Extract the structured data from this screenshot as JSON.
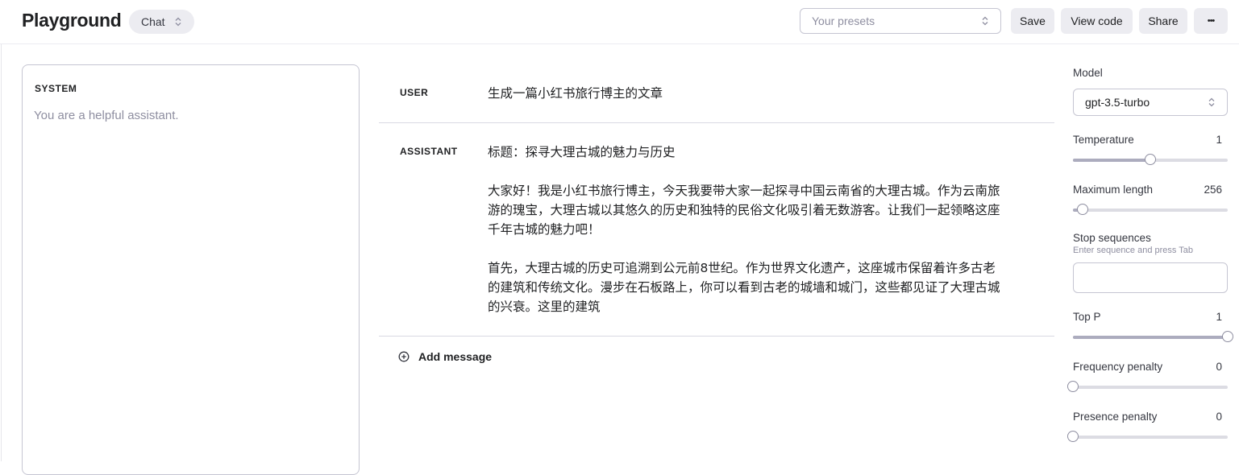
{
  "header": {
    "title": "Playground",
    "mode": "Chat",
    "presets_placeholder": "Your presets",
    "save_label": "Save",
    "view_code_label": "View code",
    "share_label": "Share",
    "more_label": "•••"
  },
  "system": {
    "label": "SYSTEM",
    "placeholder": "You are a helpful assistant."
  },
  "messages": [
    {
      "role": "USER",
      "paragraphs": [
        "生成一篇小红书旅行博主的文章"
      ]
    },
    {
      "role": "ASSISTANT",
      "paragraphs": [
        "标题：探寻大理古城的魅力与历史",
        "大家好！我是小红书旅行博主，今天我要带大家一起探寻中国云南省的大理古城。作为云南旅游的瑰宝，大理古城以其悠久的历史和独特的民俗文化吸引着无数游客。让我们一起领略这座千年古城的魅力吧！",
        "首先，大理古城的历史可追溯到公元前8世纪。作为世界文化遗产，这座城市保留着许多古老的建筑和传统文化。漫步在石板路上，你可以看到古老的城墙和城门，这些都见证了大理古城的兴衰。这里的建筑"
      ]
    }
  ],
  "add_message_label": "Add message",
  "settings": {
    "model_label": "Model",
    "model_value": "gpt-3.5-turbo",
    "temperature": {
      "label": "Temperature",
      "value": "1",
      "fraction": 0.5
    },
    "max_length": {
      "label": "Maximum length",
      "value": "256",
      "fraction": 0.06
    },
    "stop": {
      "label": "Stop sequences",
      "hint": "Enter sequence and press Tab"
    },
    "top_p": {
      "label": "Top P",
      "value": "1",
      "fraction": 1.0
    },
    "frequency_penalty": {
      "label": "Frequency penalty",
      "value": "0",
      "fraction": 0.0
    },
    "presence_penalty": {
      "label": "Presence penalty",
      "value": "0",
      "fraction": 0.0
    }
  }
}
